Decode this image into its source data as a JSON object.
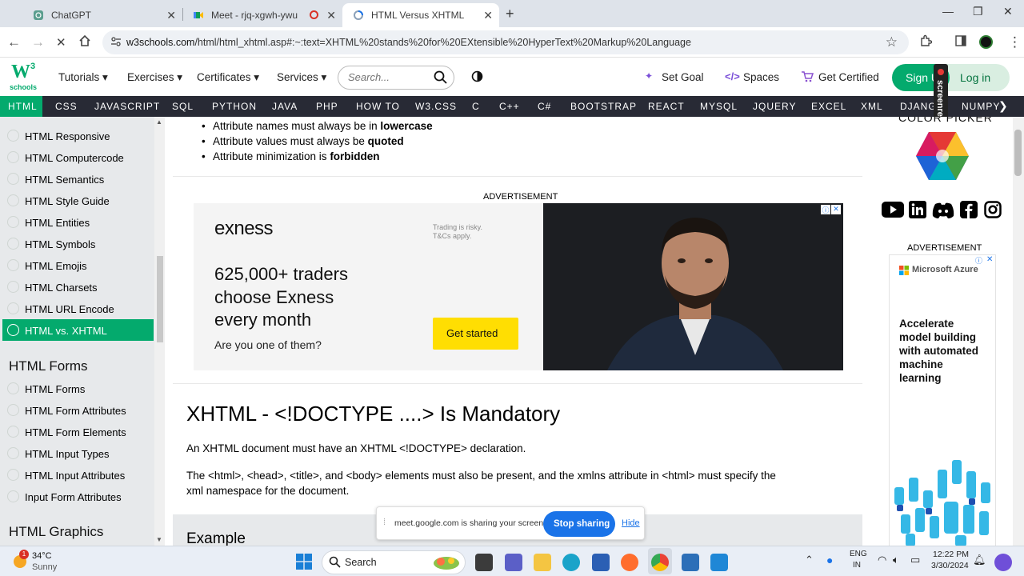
{
  "browser": {
    "tabs": [
      {
        "title": "ChatGPT",
        "active": false
      },
      {
        "title": "Meet - rjq-xgwh-ywu",
        "active": false
      },
      {
        "title": "HTML Versus XHTML",
        "active": true
      }
    ],
    "url_domain": "w3schools.com",
    "url_path": "/html/html_xhtml.asp#:~:text=XHTML%20stands%20for%20EXtensible%20HyperText%20Markup%20Language"
  },
  "w3header": {
    "logo_text": "schools",
    "logo_sup": "3",
    "nav": [
      "Tutorials",
      "Exercises",
      "Certificates",
      "Services"
    ],
    "search_placeholder": "Search...",
    "links": [
      "Set Goal",
      "Spaces",
      "Get Certified"
    ],
    "signup": "Sign Up",
    "login": "Log in"
  },
  "subjects": [
    "HTML",
    "CSS",
    "JAVASCRIPT",
    "SQL",
    "PYTHON",
    "JAVA",
    "PHP",
    "HOW TO",
    "W3.CSS",
    "C",
    "C++",
    "C#",
    "BOOTSTRAP",
    "REACT",
    "MYSQL",
    "JQUERY",
    "EXCEL",
    "XML",
    "DJANGO",
    "NUMPY"
  ],
  "sidebar": {
    "items_top": [
      "HTML Responsive",
      "HTML Computercode",
      "HTML Semantics",
      "HTML Style Guide",
      "HTML Entities",
      "HTML Symbols",
      "HTML Emojis",
      "HTML Charsets",
      "HTML URL Encode",
      "HTML vs. XHTML"
    ],
    "active_index": 9,
    "heading_forms": "HTML Forms",
    "items_forms": [
      "HTML Forms",
      "HTML Form Attributes",
      "HTML Form Elements",
      "HTML Input Types",
      "HTML Input Attributes",
      "Input Form Attributes"
    ],
    "heading_graphics": "HTML Graphics"
  },
  "main": {
    "bullets": [
      {
        "pre": "Attribute names must always be in ",
        "bold": "lowercase"
      },
      {
        "pre": "Attribute values must always be ",
        "bold": "quoted"
      },
      {
        "pre": "Attribute minimization is ",
        "bold": "forbidden"
      }
    ],
    "ad_label": "ADVERTISEMENT",
    "ad": {
      "brand": "exness",
      "disclaimer_1": "Trading is risky.",
      "disclaimer_2": "T&Cs apply.",
      "headline_1": "625,000+ traders",
      "headline_2": "choose Exness",
      "headline_3": "every month",
      "sub": "Are you one of them?",
      "cta": "Get started"
    },
    "heading": "XHTML - <!DOCTYPE ....> Is Mandatory",
    "para1": "An XHTML document must have an XHTML <!DOCTYPE> declaration.",
    "para2_line1": "The <html>, <head>, <title>, and <body> elements must also be present, and the xmlns attribute in <html> must specify the",
    "para2_line2": "xml namespace for the document.",
    "example_heading": "Example",
    "share_text": "meet.google.com is sharing your screen.",
    "share_stop": "Stop sharing",
    "share_hide": "Hide"
  },
  "rightcol": {
    "picker_label": "COLOR PICKER",
    "ad_label": "ADVERTISEMENT",
    "azure_brand": "Microsoft Azure",
    "azure_text": [
      "Accelerate",
      "model building",
      "with automated",
      "machine",
      "learning"
    ]
  },
  "taskbar": {
    "weather_temp": "34°C",
    "weather_cond": "Sunny",
    "weather_badge": "1",
    "search": "Search",
    "lang_1": "ENG",
    "lang_2": "IN",
    "time": "12:22 PM",
    "date": "3/30/2024"
  },
  "colors": {
    "w3green": "#04aa6d",
    "subjbar": "#282a35",
    "sidebar": "#e7e9eb"
  }
}
